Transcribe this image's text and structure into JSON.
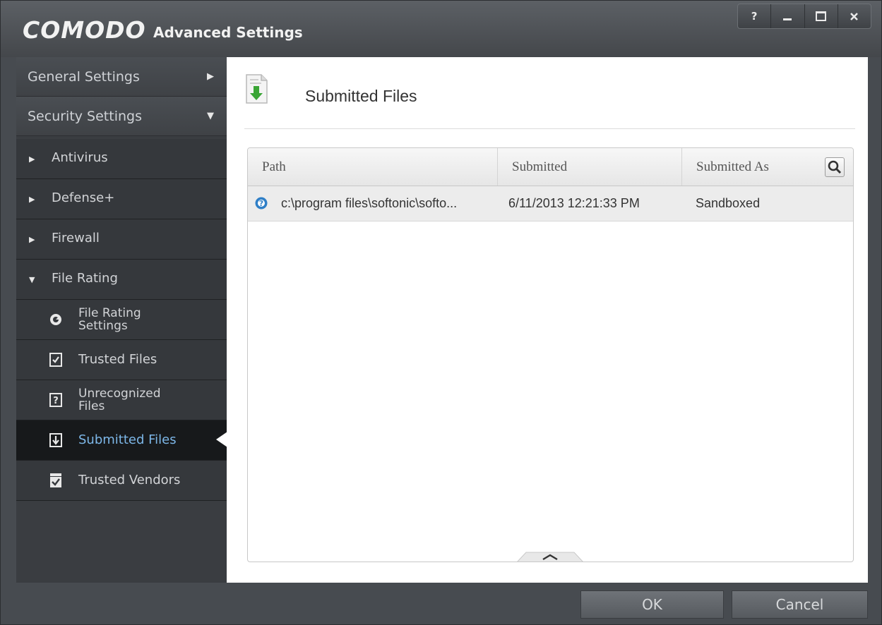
{
  "titlebar": {
    "brand": "COMODO",
    "title": "Advanced Settings",
    "help": "?"
  },
  "sidebar": {
    "general_settings": "General Settings",
    "security_settings": "Security Settings",
    "items": [
      {
        "label": "Antivirus"
      },
      {
        "label": "Defense+"
      },
      {
        "label": "Firewall"
      },
      {
        "label": "File Rating"
      }
    ],
    "sub_items": {
      "file_rating_settings": [
        "File Rating",
        "Settings"
      ],
      "trusted_files": "Trusted Files",
      "unrecognized_files": [
        "Unrecognized",
        "Files"
      ],
      "submitted_files": "Submitted Files",
      "trusted_vendors": "Trusted Vendors"
    }
  },
  "main": {
    "title": "Submitted Files",
    "columns": [
      "Path",
      "Submitted",
      "Submitted As"
    ],
    "rows": [
      {
        "path": "c:\\program files\\softonic\\softo...",
        "submitted": "6/11/2013 12:21:33 PM",
        "submitted_as": "Sandboxed"
      }
    ]
  },
  "footer": {
    "ok": "OK",
    "cancel": "Cancel"
  },
  "colors": {
    "active_item_text": "#7db7e8",
    "download_arrow": "#3aa535"
  }
}
